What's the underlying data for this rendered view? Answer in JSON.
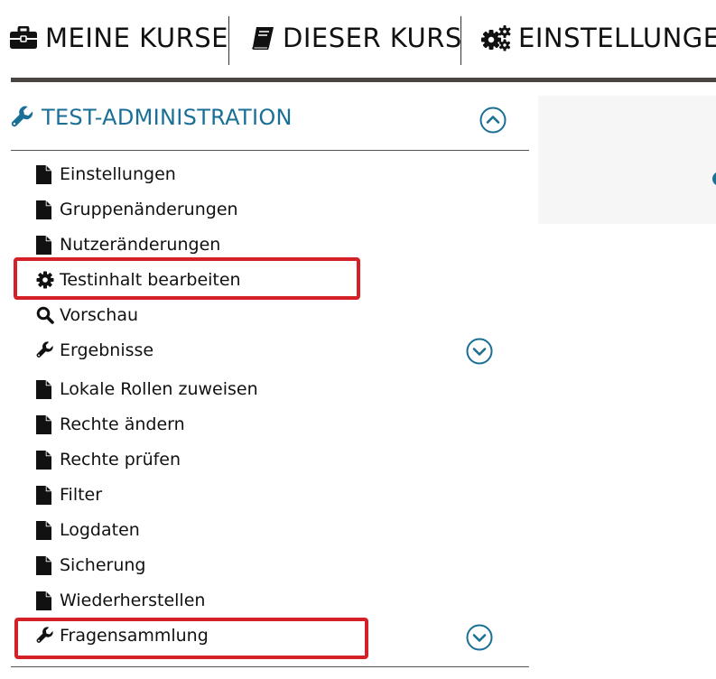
{
  "nav": {
    "items": [
      {
        "label": "MEINE KURSE",
        "icon": "briefcase-icon"
      },
      {
        "label": "DIESER KURS",
        "icon": "book-icon"
      },
      {
        "label": "EINSTELLUNGEN",
        "icon": "cogs-icon"
      }
    ]
  },
  "block": {
    "title": "TEST-ADMINISTRATION",
    "title_icon": "wrench-icon",
    "accent_color": "#1a6f96",
    "items": [
      {
        "label": "Einstellungen",
        "icon": "file-icon"
      },
      {
        "label": "Gruppenänderungen",
        "icon": "file-icon"
      },
      {
        "label": "Nutzeränderungen",
        "icon": "file-icon"
      },
      {
        "label": "Testinhalt bearbeiten",
        "icon": "gear-icon",
        "highlighted": true
      },
      {
        "label": "Vorschau",
        "icon": "search-icon"
      },
      {
        "label": "Ergebnisse",
        "icon": "wrench-icon",
        "expandable": true
      },
      {
        "label": "Lokale Rollen zuweisen",
        "icon": "file-icon"
      },
      {
        "label": "Rechte ändern",
        "icon": "file-icon"
      },
      {
        "label": "Rechte prüfen",
        "icon": "file-icon"
      },
      {
        "label": "Filter",
        "icon": "file-icon"
      },
      {
        "label": "Logdaten",
        "icon": "file-icon"
      },
      {
        "label": "Sicherung",
        "icon": "file-icon"
      },
      {
        "label": "Wiederherstellen",
        "icon": "file-icon"
      },
      {
        "label": "Fragensammlung",
        "icon": "wrench-icon",
        "expandable": true,
        "highlighted": true
      }
    ]
  },
  "highlight_color": "#d42027"
}
